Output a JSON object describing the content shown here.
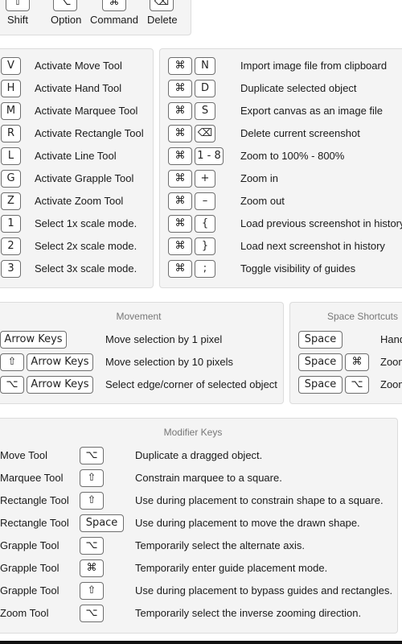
{
  "top_modifiers": [
    {
      "glyph": "⇧",
      "label": "Shift"
    },
    {
      "glyph": "⌥",
      "label": "Option"
    },
    {
      "glyph": "⌘",
      "label": "Command"
    },
    {
      "glyph": "⌫",
      "label": "Delete"
    }
  ],
  "tools": [
    {
      "key": "V",
      "label": "Activate Move Tool"
    },
    {
      "key": "H",
      "label": "Activate Hand Tool"
    },
    {
      "key": "M",
      "label": "Activate Marquee Tool"
    },
    {
      "key": "R",
      "label": "Activate Rectangle Tool"
    },
    {
      "key": "L",
      "label": "Activate Line Tool"
    },
    {
      "key": "G",
      "label": "Activate Grapple Tool"
    },
    {
      "key": "Z",
      "label": "Activate Zoom Tool"
    },
    {
      "key": "1",
      "label": "Select 1x scale mode."
    },
    {
      "key": "2",
      "label": "Select 2x scale mode."
    },
    {
      "key": "3",
      "label": "Select 3x scale mode."
    }
  ],
  "command_shortcuts": [
    {
      "mod": "⌘",
      "key": "N",
      "label": "Import image file from clipboard"
    },
    {
      "mod": "⌘",
      "key": "D",
      "label": "Duplicate selected object"
    },
    {
      "mod": "⌘",
      "key": "S",
      "label": "Export canvas as an image file"
    },
    {
      "mod": "⌘",
      "key": "⌫",
      "label": "Delete current screenshot"
    },
    {
      "mod": "⌘",
      "key": "1 - 8",
      "label": "Zoom to 100% - 800%"
    },
    {
      "mod": "⌘",
      "key": "+",
      "label": "Zoom in"
    },
    {
      "mod": "⌘",
      "key": "–",
      "label": "Zoom out"
    },
    {
      "mod": "⌘",
      "key": "{",
      "label": "Load previous screenshot in history"
    },
    {
      "mod": "⌘",
      "key": "}",
      "label": "Load next screenshot in history"
    },
    {
      "mod": "⌘",
      "key": ";",
      "label": "Toggle visibility of guides"
    }
  ],
  "movement": {
    "title": "Movement",
    "rows": [
      {
        "mod": "",
        "key": "Arrow Keys",
        "label": "Move selection by 1 pixel"
      },
      {
        "mod": "⇧",
        "key": "Arrow Keys",
        "label": "Move selection by 10 pixels"
      },
      {
        "mod": "⌥",
        "key": "Arrow Keys",
        "label": "Select edge/corner of selected object"
      }
    ]
  },
  "space_shortcuts": {
    "title": "Space Shortcuts",
    "rows": [
      {
        "key": "Space",
        "mod": "",
        "label": "Hand"
      },
      {
        "key": "Space",
        "mod": "⌘",
        "label": "Zoom"
      },
      {
        "key": "Space",
        "mod": "⌥",
        "label": "Zoom"
      }
    ]
  },
  "modifier_keys": {
    "title": "Modifier Keys",
    "rows": [
      {
        "tool": "Move Tool",
        "key": "⌥",
        "label": "Duplicate a dragged object."
      },
      {
        "tool": "Marquee Tool",
        "key": "⇧",
        "label": "Constrain marquee to a square."
      },
      {
        "tool": "Rectangle Tool",
        "key": "⇧",
        "label": "Use during placement to constrain shape to a square."
      },
      {
        "tool": "Rectangle Tool",
        "key": "Space",
        "label": "Use during placement to move the drawn shape."
      },
      {
        "tool": "Grapple Tool",
        "key": "⌥",
        "label": "Temporarily select the alternate axis."
      },
      {
        "tool": "Grapple Tool",
        "key": "⌘",
        "label": "Temporarily enter guide placement mode."
      },
      {
        "tool": "Grapple Tool",
        "key": "⇧",
        "label": "Use during placement to bypass guides and rectangles."
      },
      {
        "tool": "Zoom Tool",
        "key": "⌥",
        "label": "Temporarily select the inverse zooming direction."
      }
    ]
  }
}
